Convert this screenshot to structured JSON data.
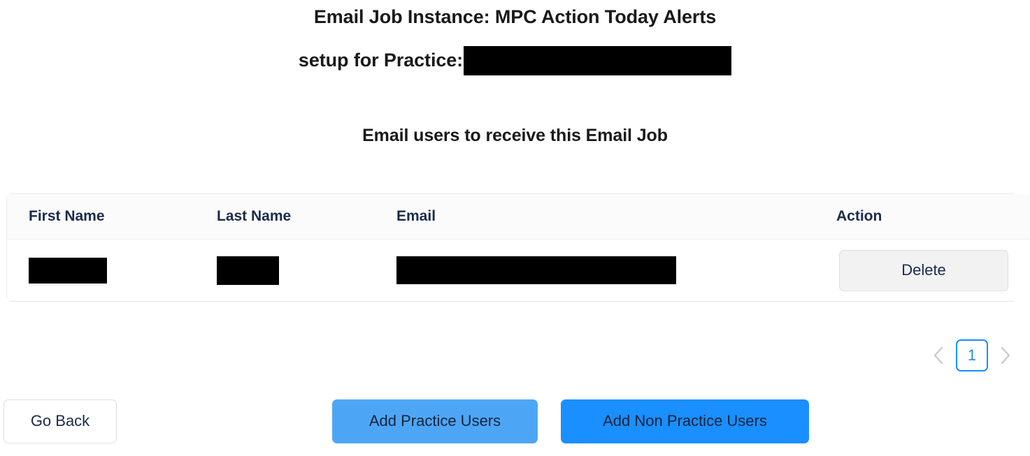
{
  "header": {
    "title_line_1": "Email Job Instance: MPC Action Today Alerts",
    "title_line_2": "setup for Practice:",
    "practice_name_redacted": true,
    "section_heading": "Email users to receive this Email Job"
  },
  "table": {
    "columns": [
      "First Name",
      "Last Name",
      "Email",
      "Action"
    ],
    "rows": [
      {
        "first_name": "",
        "first_name_redacted": true,
        "last_name": "",
        "last_name_redacted": true,
        "email": "",
        "email_redacted": true,
        "action_label": "Delete"
      }
    ]
  },
  "pagination": {
    "prev_icon": "chevron-left-icon",
    "next_icon": "chevron-right-icon",
    "current_page": "1",
    "active_color": "#1a8fff",
    "arrow_color": "#c9cacc"
  },
  "footer": {
    "go_back_label": "Go Back",
    "add_practice_users_label": "Add Practice Users",
    "add_non_practice_users_label": "Add Non Practice Users",
    "add_practice_color": "#4da6f5",
    "add_non_practice_color": "#1a8fff"
  },
  "colors": {
    "page_background": "#ffffff",
    "heading_text": "#1a1a1a",
    "table_header_text": "#1b2b4b",
    "table_header_background": "#fbfbfb",
    "card_border": "#e9e9ea",
    "delete_button_background": "#f2f2f2",
    "redaction": "#000000"
  }
}
